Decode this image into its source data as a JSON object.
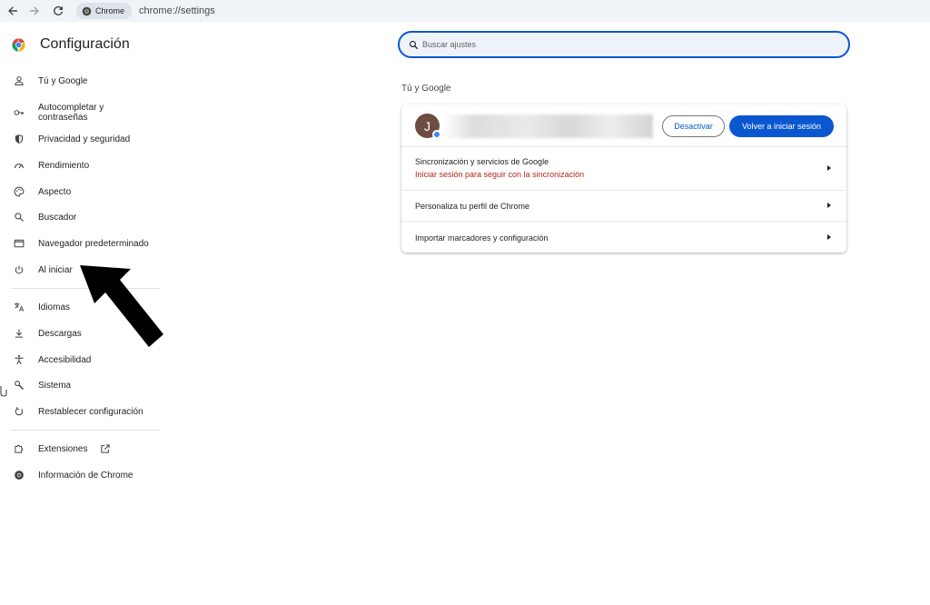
{
  "browser": {
    "chip_label": "Chrome",
    "url": "chrome://settings"
  },
  "app": {
    "title": "Configuración"
  },
  "sidebar": {
    "items": [
      {
        "label": "Tú y Google",
        "icon": "person-icon"
      },
      {
        "label": "Autocompletar y contraseñas",
        "icon": "key-icon"
      },
      {
        "label": "Privacidad y seguridad",
        "icon": "shield-icon"
      },
      {
        "label": "Rendimiento",
        "icon": "speedometer-icon"
      },
      {
        "label": "Aspecto",
        "icon": "palette-icon"
      },
      {
        "label": "Buscador",
        "icon": "search-icon"
      },
      {
        "label": "Navegador predeterminado",
        "icon": "browser-window-icon"
      },
      {
        "label": "Al iniciar",
        "icon": "power-icon"
      },
      {
        "label": "Idiomas",
        "icon": "translate-icon"
      },
      {
        "label": "Descargas",
        "icon": "download-icon"
      },
      {
        "label": "Accesibilidad",
        "icon": "accessibility-icon"
      },
      {
        "label": "Sistema",
        "icon": "wrench-icon"
      },
      {
        "label": "Restablecer configuración",
        "icon": "reset-icon"
      },
      {
        "label": "Extensiones",
        "icon": "puzzle-icon"
      },
      {
        "label": "Información de Chrome",
        "icon": "chrome-icon"
      }
    ]
  },
  "search": {
    "placeholder": "Buscar ajustes"
  },
  "main": {
    "section_title": "Tú y Google",
    "account": {
      "avatar_initial": "J",
      "deactivate_label": "Desactivar",
      "signin_label": "Volver a iniciar sesión"
    },
    "rows": [
      {
        "title": "Sincronización y servicios de Google",
        "subtitle": "Iniciar sesión para seguir con la sincronización"
      },
      {
        "title": "Personaliza tu perfil de Chrome"
      },
      {
        "title": "Importar marcadores y configuración"
      }
    ]
  },
  "colors": {
    "accent": "#0b57d0",
    "error_text": "#b3261e"
  }
}
